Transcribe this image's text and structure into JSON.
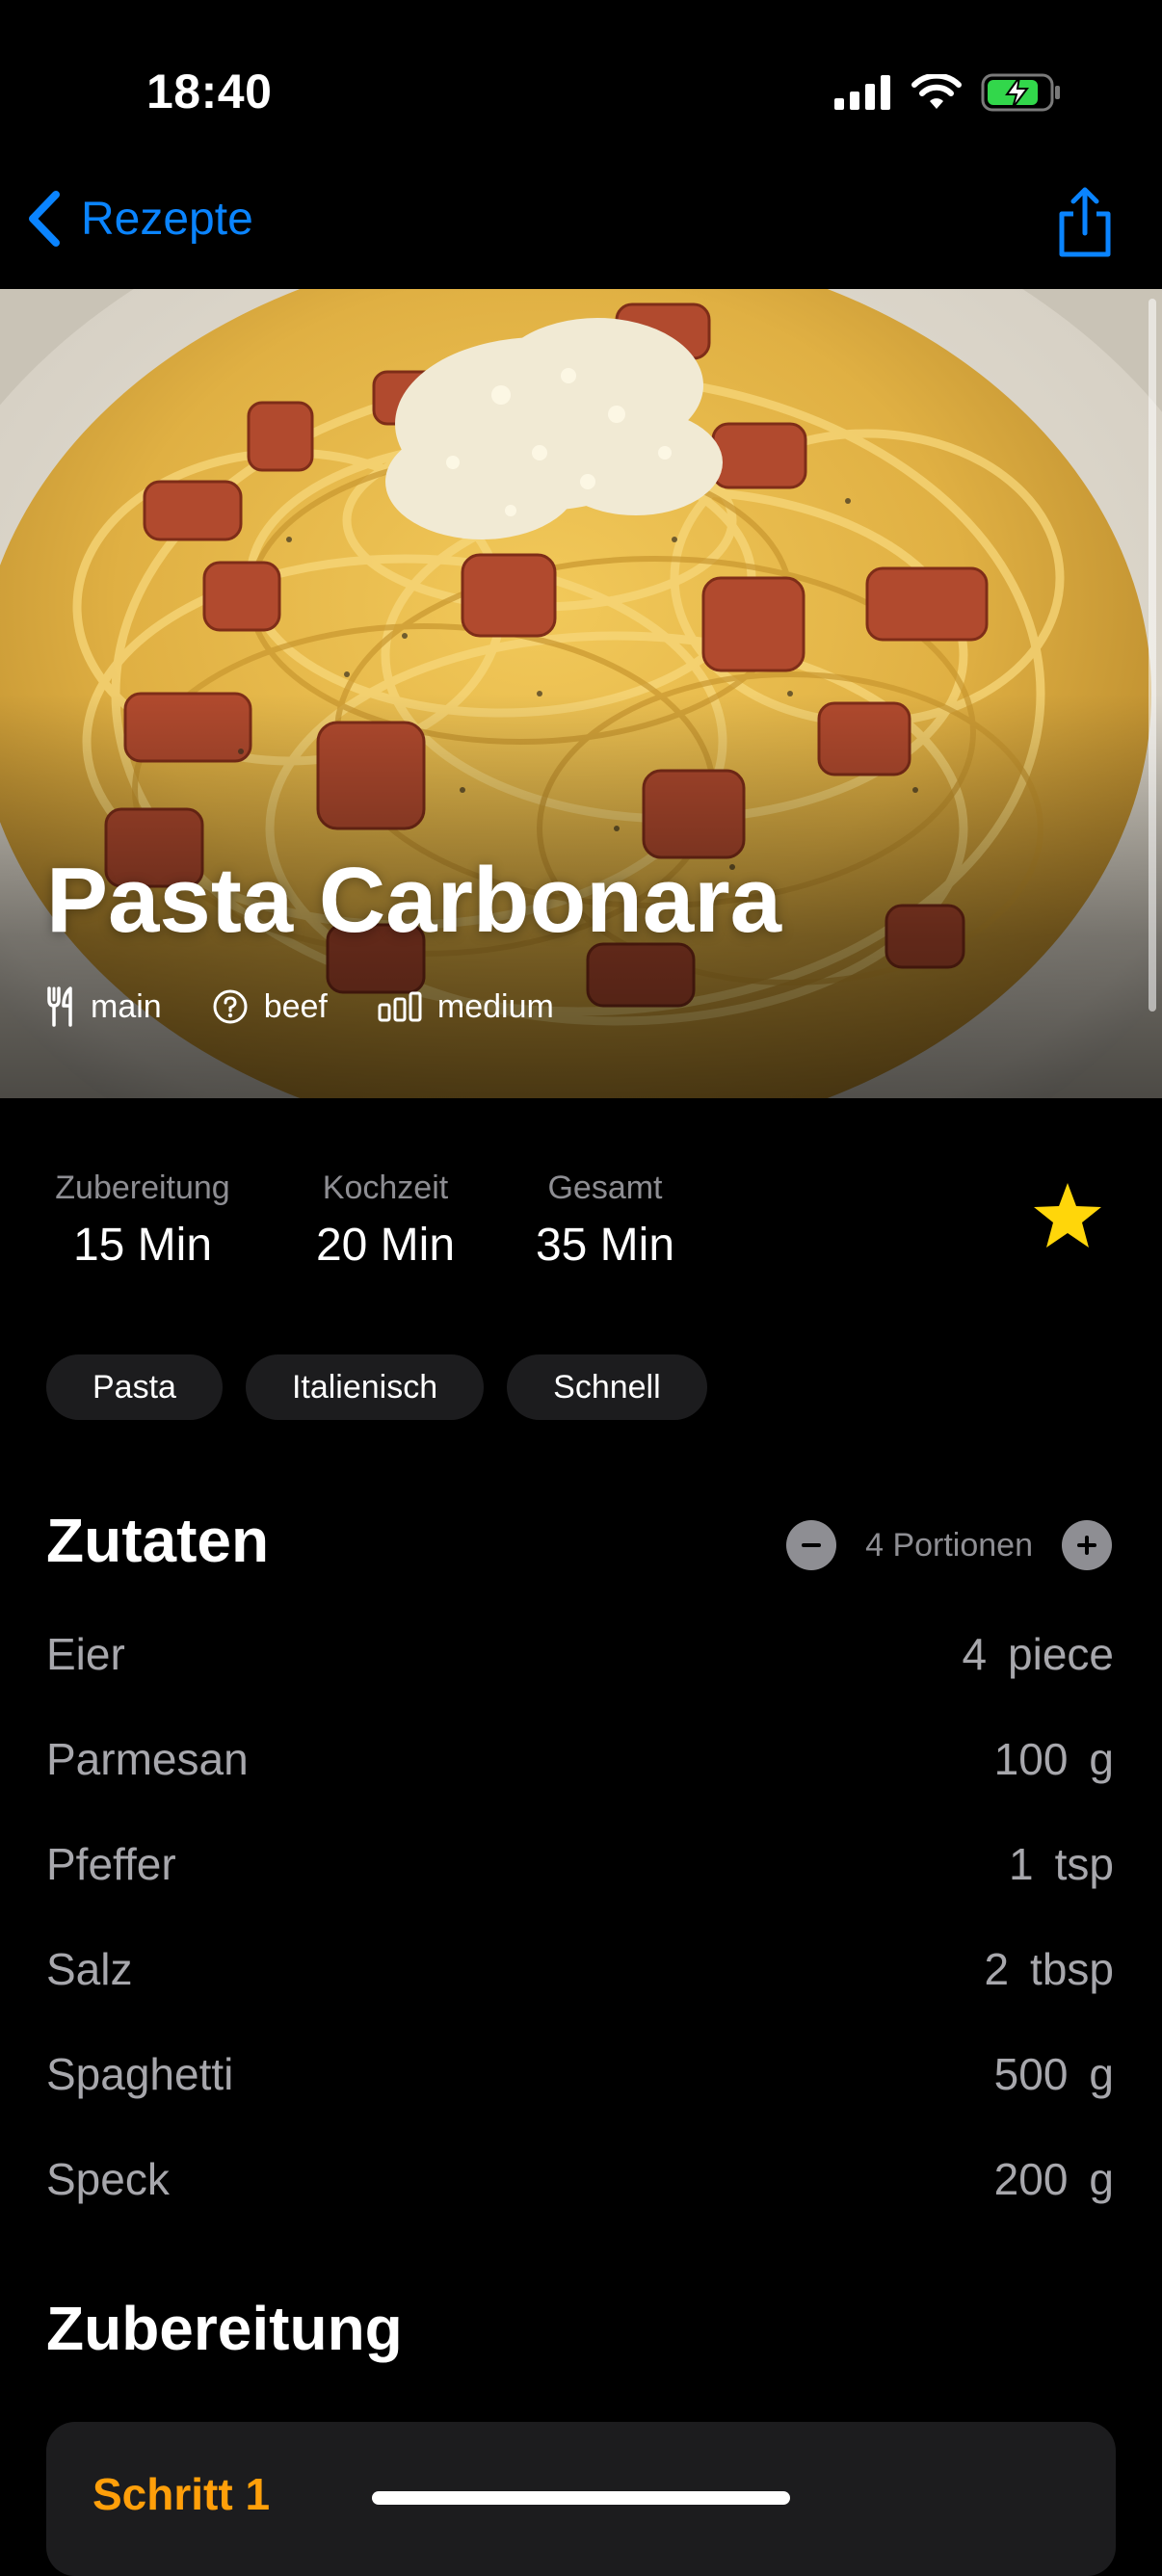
{
  "status_bar": {
    "time": "18:40"
  },
  "nav": {
    "back_label": "Rezepte"
  },
  "recipe": {
    "title": "Pasta Carbonara",
    "meta": {
      "category": "main",
      "protein": "beef",
      "difficulty": "medium"
    },
    "times": [
      {
        "label": "Zubereitung",
        "value": "15 Min"
      },
      {
        "label": "Kochzeit",
        "value": "20 Min"
      },
      {
        "label": "Gesamt",
        "value": "35 Min"
      }
    ],
    "favorite": true,
    "tags": [
      "Pasta",
      "Italienisch",
      "Schnell"
    ]
  },
  "ingredients": {
    "title": "Zutaten",
    "servings_label": "4 Portionen",
    "items": [
      {
        "name": "Eier",
        "amount": "4",
        "unit": "piece"
      },
      {
        "name": "Parmesan",
        "amount": "100",
        "unit": "g"
      },
      {
        "name": "Pfeffer",
        "amount": "1",
        "unit": "tsp"
      },
      {
        "name": "Salz",
        "amount": "2",
        "unit": "tbsp"
      },
      {
        "name": "Spaghetti",
        "amount": "500",
        "unit": "g"
      },
      {
        "name": "Speck",
        "amount": "200",
        "unit": "g"
      }
    ]
  },
  "preparation": {
    "title": "Zubereitung",
    "steps": [
      {
        "label": "Schritt 1"
      }
    ]
  },
  "colors": {
    "accent": "#0A84FF",
    "star": "#FFD60A",
    "step_label": "#FF9F0A",
    "secondary_text": "#8E8E93",
    "tag_bg": "#1C1C1E",
    "battery_fill": "#32D74B"
  }
}
